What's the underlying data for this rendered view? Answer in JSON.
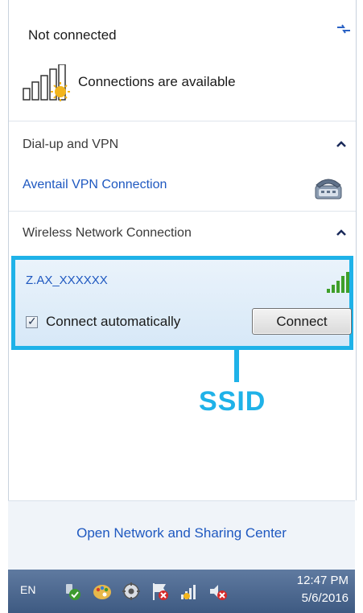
{
  "header": {
    "title": "Not connected",
    "status_text": "Connections are available"
  },
  "sections": {
    "dialup": {
      "title": "Dial-up and VPN",
      "vpn_link": "Aventail VPN Connection"
    },
    "wireless": {
      "title": "Wireless Network Connection",
      "network": {
        "ssid": "Z.AX_XXXXXX",
        "connect_automatically_label": "Connect automatically",
        "connect_automatically_checked": true,
        "connect_button": "Connect",
        "signal_level": "5/5"
      }
    }
  },
  "callout": {
    "label": "SSID",
    "color": "#1fb2e8"
  },
  "footer": {
    "open_center_link": "Open Network and Sharing Center"
  },
  "taskbar": {
    "language": "EN",
    "time": "12:47 PM",
    "date": "5/6/2016",
    "tray_icons": [
      "action-center-icon",
      "paint-palette-icon",
      "gear-app-icon",
      "flag-error-icon",
      "network-signal-icon",
      "volume-muted-icon"
    ]
  },
  "colors": {
    "link_blue": "#1e58c0",
    "taskbar_blue": "#4a6690",
    "highlight_cyan": "#1fb2e8"
  }
}
